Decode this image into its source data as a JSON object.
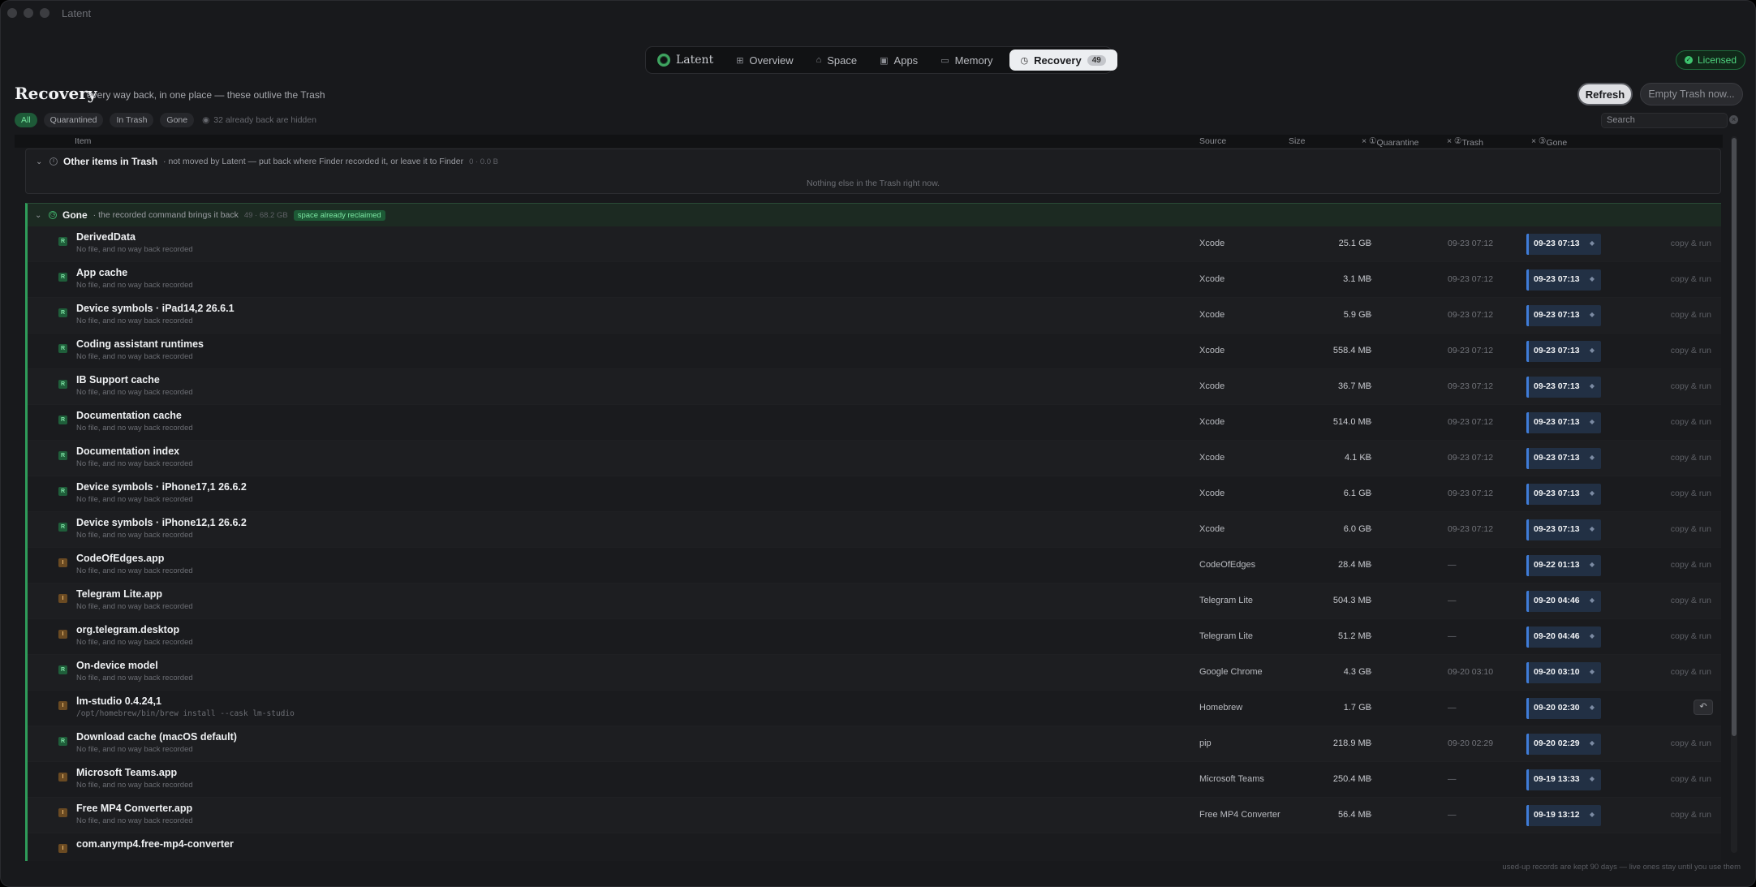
{
  "window": {
    "title": "Latent"
  },
  "nav": {
    "logo": "Latent",
    "tabs": [
      {
        "label": "Overview",
        "icon": "grid-icon"
      },
      {
        "label": "Space",
        "icon": "drive-icon"
      },
      {
        "label": "Apps",
        "icon": "app-icon"
      },
      {
        "label": "Memory",
        "icon": "memory-icon"
      }
    ],
    "active_tab": {
      "label": "Recovery",
      "icon": "history-icon",
      "count": "49"
    }
  },
  "license": {
    "label": "Licensed",
    "color": "#4fd57f"
  },
  "header": {
    "title": "Recovery",
    "subtitle": "every way back, in one place — these outlive the Trash",
    "refresh_label": "Refresh",
    "empty_trash_label": "Empty Trash now..."
  },
  "filters": {
    "chips": [
      "All",
      "Quarantined",
      "In Trash",
      "Gone"
    ],
    "active": "All",
    "hidden_note": "32 already back are hidden"
  },
  "search": {
    "placeholder": "Search"
  },
  "columns": {
    "item": "Item",
    "source": "Source",
    "size": "Size",
    "quarantine": "Quarantine",
    "trash": "Trash",
    "gone": "Gone"
  },
  "other_section": {
    "name": "Other items in Trash",
    "desc": "· not moved by Latent — put back where Finder recorded it, or leave it to Finder",
    "meta": "0 · 0.0 B",
    "empty": "Nothing else in the Trash right now."
  },
  "gone_section": {
    "name": "Gone",
    "desc": "· the recorded command brings it back",
    "meta": "49 · 68.2 GB",
    "badge": "space already reclaimed",
    "accent": "#2f9c5a"
  },
  "rows": [
    {
      "icon": "green",
      "glyph": "R",
      "name": "DerivedData",
      "sub": "No file, and no way back recorded",
      "source": "Xcode",
      "size": "25.1 GB",
      "quarantine": "—",
      "trash": "09-23 07:12",
      "gone": "09-23 07:13",
      "action": "copy & run"
    },
    {
      "icon": "green",
      "glyph": "R",
      "name": "App cache",
      "sub": "No file, and no way back recorded",
      "source": "Xcode",
      "size": "3.1 MB",
      "quarantine": "—",
      "trash": "09-23 07:12",
      "gone": "09-23 07:13",
      "action": "copy & run"
    },
    {
      "icon": "green",
      "glyph": "R",
      "name": "Device symbols · iPad14,2 26.6.1",
      "sub": "No file, and no way back recorded",
      "source": "Xcode",
      "size": "5.9 GB",
      "quarantine": "—",
      "trash": "09-23 07:12",
      "gone": "09-23 07:13",
      "action": "copy & run"
    },
    {
      "icon": "green",
      "glyph": "R",
      "name": "Coding assistant runtimes",
      "sub": "No file, and no way back recorded",
      "source": "Xcode",
      "size": "558.4 MB",
      "quarantine": "—",
      "trash": "09-23 07:12",
      "gone": "09-23 07:13",
      "action": "copy & run"
    },
    {
      "icon": "green",
      "glyph": "R",
      "name": "IB Support cache",
      "sub": "No file, and no way back recorded",
      "source": "Xcode",
      "size": "36.7 MB",
      "quarantine": "—",
      "trash": "09-23 07:12",
      "gone": "09-23 07:13",
      "action": "copy & run"
    },
    {
      "icon": "green",
      "glyph": "R",
      "name": "Documentation cache",
      "sub": "No file, and no way back recorded",
      "source": "Xcode",
      "size": "514.0 MB",
      "quarantine": "—",
      "trash": "09-23 07:12",
      "gone": "09-23 07:13",
      "action": "copy & run"
    },
    {
      "icon": "green",
      "glyph": "R",
      "name": "Documentation index",
      "sub": "No file, and no way back recorded",
      "source": "Xcode",
      "size": "4.1 KB",
      "quarantine": "—",
      "trash": "09-23 07:12",
      "gone": "09-23 07:13",
      "action": "copy & run"
    },
    {
      "icon": "green",
      "glyph": "R",
      "name": "Device symbols · iPhone17,1 26.6.2",
      "sub": "No file, and no way back recorded",
      "source": "Xcode",
      "size": "6.1 GB",
      "quarantine": "—",
      "trash": "09-23 07:12",
      "gone": "09-23 07:13",
      "action": "copy & run"
    },
    {
      "icon": "green",
      "glyph": "R",
      "name": "Device symbols · iPhone12,1 26.6.2",
      "sub": "No file, and no way back recorded",
      "source": "Xcode",
      "size": "6.0 GB",
      "quarantine": "—",
      "trash": "09-23 07:12",
      "gone": "09-23 07:13",
      "action": "copy & run"
    },
    {
      "icon": "orange",
      "glyph": "I",
      "name": "CodeOfEdges.app",
      "sub": "No file, and no way back recorded",
      "source": "CodeOfEdges",
      "size": "28.4 MB",
      "quarantine": "—",
      "trash": "—",
      "gone": "09-22 01:13",
      "action": "copy & run"
    },
    {
      "icon": "orange",
      "glyph": "I",
      "name": "Telegram Lite.app",
      "sub": "No file, and no way back recorded",
      "source": "Telegram Lite",
      "size": "504.3 MB",
      "quarantine": "—",
      "trash": "—",
      "gone": "09-20 04:46",
      "action": "copy & run"
    },
    {
      "icon": "orange",
      "glyph": "I",
      "name": "org.telegram.desktop",
      "sub": "No file, and no way back recorded",
      "source": "Telegram Lite",
      "size": "51.2 MB",
      "quarantine": "—",
      "trash": "—",
      "gone": "09-20 04:46",
      "action": "copy & run"
    },
    {
      "icon": "green",
      "glyph": "R",
      "name": "On-device model",
      "sub": "No file, and no way back recorded",
      "source": "Google Chrome",
      "size": "4.3 GB",
      "quarantine": "—",
      "trash": "09-20 03:10",
      "gone": "09-20 03:10",
      "action": "copy & run"
    },
    {
      "icon": "orange",
      "glyph": "I",
      "name": "lm-studio 0.4.24,1",
      "sub": "/opt/homebrew/bin/brew install --cask lm-studio",
      "sub_mono": true,
      "source": "Homebrew",
      "size": "1.7 GB",
      "quarantine": "—",
      "trash": "—",
      "gone": "09-20 02:30",
      "action": "",
      "undo": "↶"
    },
    {
      "icon": "green",
      "glyph": "R",
      "name": "Download cache (macOS default)",
      "sub": "No file, and no way back recorded",
      "source": "pip",
      "size": "218.9 MB",
      "quarantine": "—",
      "trash": "09-20 02:29",
      "gone": "09-20 02:29",
      "action": "copy & run"
    },
    {
      "icon": "orange",
      "glyph": "I",
      "name": "Microsoft Teams.app",
      "sub": "No file, and no way back recorded",
      "source": "Microsoft Teams",
      "size": "250.4 MB",
      "quarantine": "—",
      "trash": "—",
      "gone": "09-19 13:33",
      "action": "copy & run"
    },
    {
      "icon": "orange",
      "glyph": "I",
      "name": "Free MP4 Converter.app",
      "sub": "No file, and no way back recorded",
      "source": "Free MP4 Converter",
      "size": "56.4 MB",
      "quarantine": "—",
      "trash": "—",
      "gone": "09-19 13:12",
      "action": "copy & run"
    },
    {
      "icon": "orange",
      "glyph": "I",
      "name": "com.anymp4.free-mp4-converter",
      "sub": "",
      "source": "",
      "size": "",
      "quarantine": "",
      "trash": "",
      "gone": "",
      "action": ""
    }
  ],
  "footer": {
    "note": "used-up records are kept 90 days — live ones stay until you use them"
  }
}
